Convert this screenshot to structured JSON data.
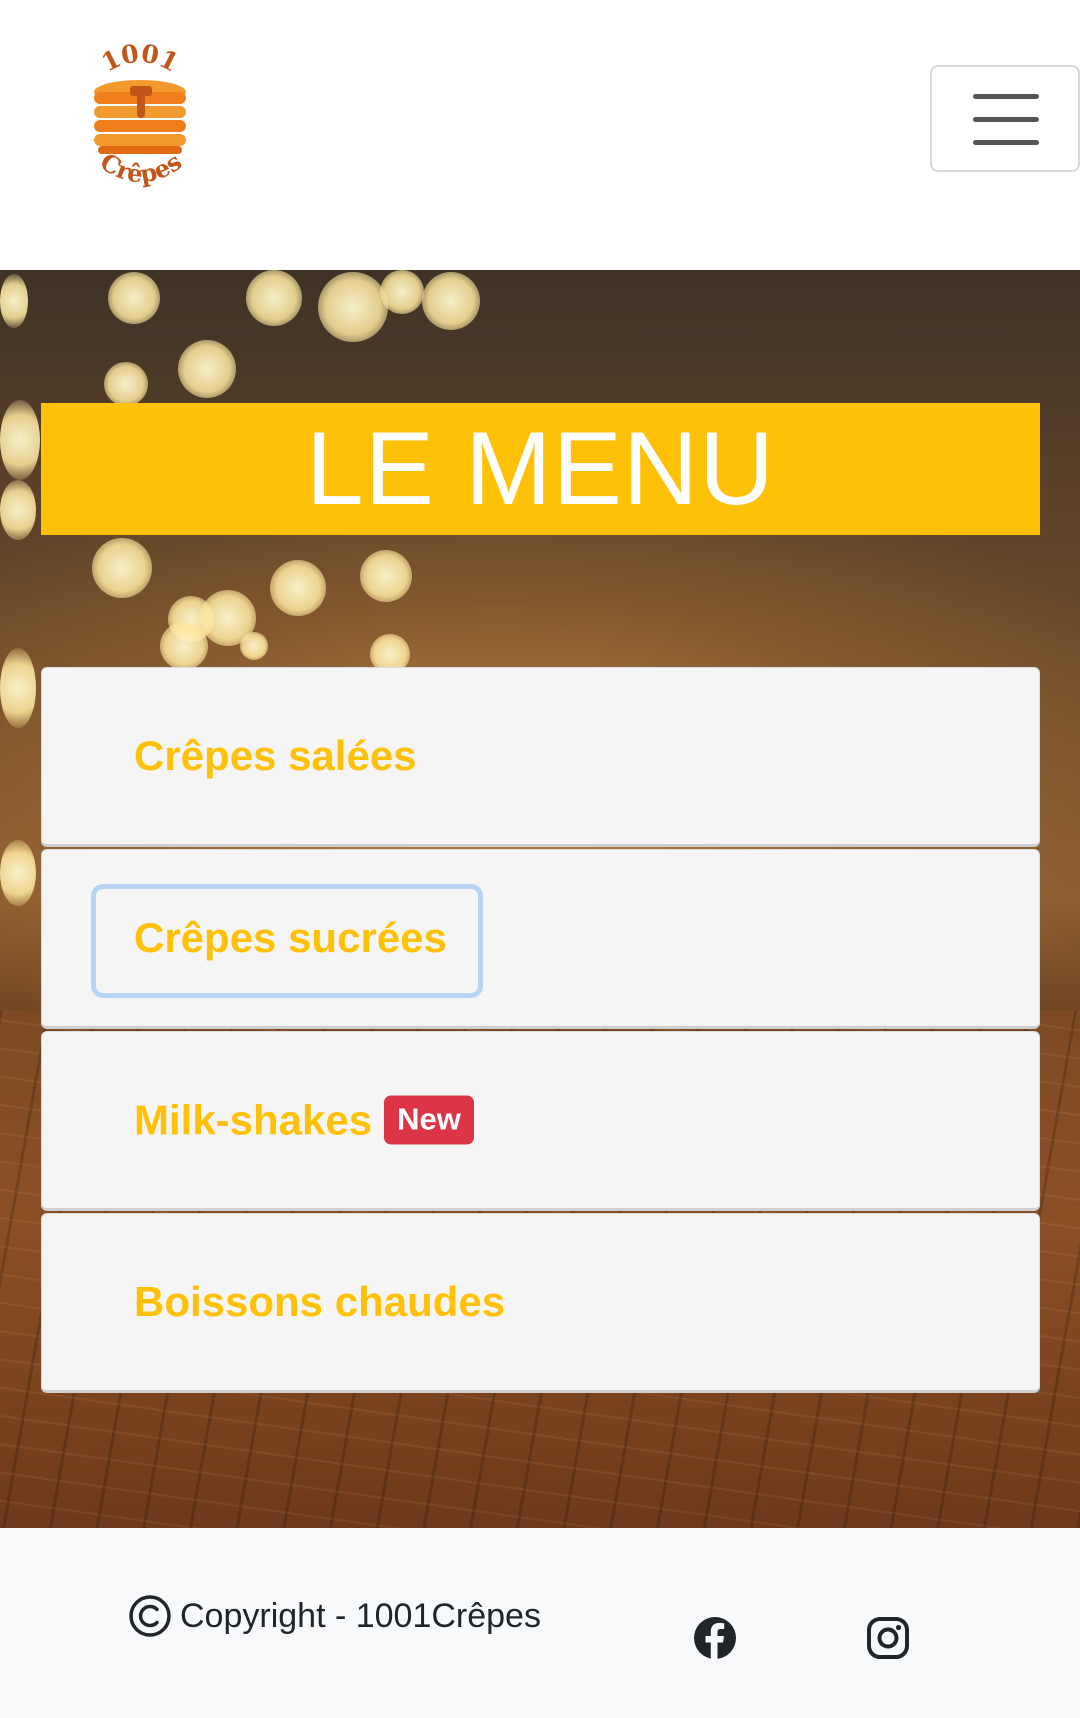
{
  "header": {
    "logo": {
      "top_text": "1001",
      "bottom_text": "Crêpes",
      "icon": "pancake-stack-logo"
    },
    "menu_toggle_icon": "hamburger-icon"
  },
  "hero": {
    "title": "LE MENU",
    "items": [
      {
        "label": "Crêpes salées"
      },
      {
        "label": "Crêpes sucrées"
      },
      {
        "label": "Milk-shakes",
        "badge": "New"
      },
      {
        "label": "Boissons chaudes"
      }
    ]
  },
  "footer": {
    "copyright_icon": "copyright-icon",
    "copyright_text": "Copyright - 1001Crêpes",
    "social": [
      {
        "icon": "facebook-icon"
      },
      {
        "icon": "instagram-icon"
      }
    ]
  },
  "colors": {
    "accent": "#ffc107",
    "badge": "#dc3545",
    "item_background": "#f5f5f5",
    "footer_background": "#f8f9fa"
  }
}
